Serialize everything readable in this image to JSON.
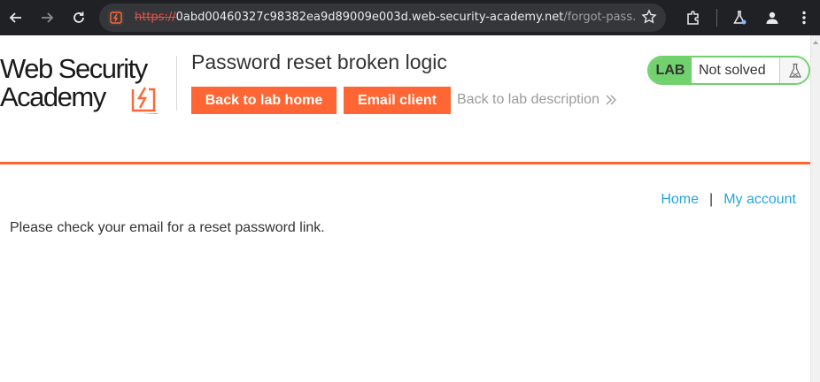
{
  "browser": {
    "url_scheme": "https://",
    "url_host": "0abd00460327c98382ea9d89009e003d.web-security-academy.net",
    "url_path": "/forgot-pass...",
    "icons": [
      "back-arrow-icon",
      "forward-arrow-icon",
      "reload-icon",
      "site-security-icon",
      "star-icon",
      "extensions-icon",
      "labs-icon",
      "profile-icon",
      "menu-icon"
    ]
  },
  "header": {
    "logo_line1": "Web Security",
    "logo_line2": "Academy",
    "lab_title": "Password reset broken logic",
    "back_to_lab_home": "Back to lab home",
    "email_client": "Email client",
    "back_to_description": "Back to lab description"
  },
  "status": {
    "badge": "LAB",
    "text": "Not solved",
    "icon": "flask-icon"
  },
  "nav": {
    "home": "Home",
    "separator": "|",
    "my_account": "My account"
  },
  "main": {
    "message": "Please check your email for a reset password link."
  },
  "colors": {
    "accent": "#ff6633",
    "status_green": "#70d16d",
    "link_blue": "#29a4d6",
    "toolbar_bg": "#202124"
  }
}
